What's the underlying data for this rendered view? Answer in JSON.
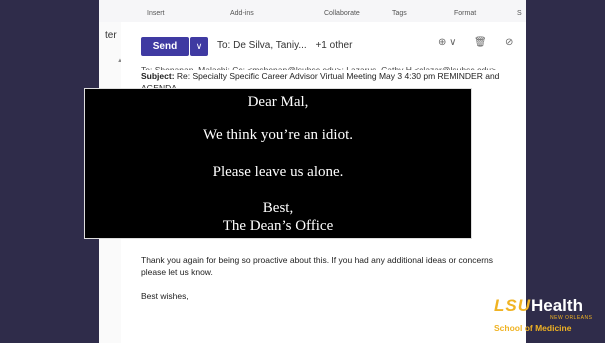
{
  "menubar": {
    "items": [
      "Insert",
      "Add-ins",
      "Collaborate",
      "Tags",
      "Format",
      "S"
    ]
  },
  "leftpane": {
    "fragment": "ter"
  },
  "compose": {
    "send_label": "Send",
    "to_label": "To:",
    "to_value": "De Silva, Taniy...",
    "to_more": "+1 other"
  },
  "email": {
    "cut_line": "To: Shenanan, Malachi; Cc: <mshenan@lsuhsc.edu>; Lazarus, Cathy H <clazar@lsuhsc.edu>",
    "subject_label": "Subject:",
    "subject_value": "Re: Specialty Specific Career Advisor Virtual Meeting May 3 4:30 pm REMINDER and",
    "subject_cont": "AGENDA",
    "para": "Thank you again for being so proactive about this. If you had any additional ideas or concerns please let us know.",
    "signoff": "Best wishes,"
  },
  "overlay": {
    "line1": "Dear Mal,",
    "line2": "We think you’re an idiot.",
    "line3": "Please leave us alone.",
    "line4": "Best,",
    "line5": "The Dean’s Office"
  },
  "logo": {
    "lsu": "LSU",
    "health": "Health",
    "new_orleans": "NEW ORLEANS",
    "school": "School of Medicine"
  },
  "colors": {
    "slide_bg": "#2f2c4a",
    "send_button": "#3f3aa2",
    "logo_gold": "#f0b323"
  }
}
